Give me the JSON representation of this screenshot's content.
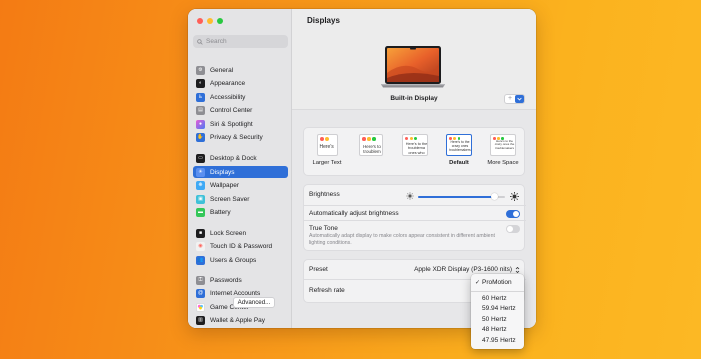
{
  "window": {
    "title": "Displays"
  },
  "sidebar": {
    "search_placeholder": "Search",
    "items": [
      {
        "label": "General",
        "icon": "gear-icon",
        "color": "#8e8e93"
      },
      {
        "label": "Appearance",
        "icon": "appearance-icon",
        "color": "#1d1d1f"
      },
      {
        "label": "Accessibility",
        "icon": "accessibility-icon",
        "color": "#2f6fd8"
      },
      {
        "label": "Control Center",
        "icon": "control-center-icon",
        "color": "#8e8e93"
      },
      {
        "label": "Siri & Spotlight",
        "icon": "siri-icon",
        "color": "#6b4de6"
      },
      {
        "label": "Privacy & Security",
        "icon": "hand-icon",
        "color": "#2f6fd8"
      },
      {
        "label": "Desktop & Dock",
        "icon": "dock-icon",
        "color": "#1d1d1f"
      },
      {
        "label": "Displays",
        "icon": "sun-icon",
        "color": "#2f6fd8",
        "active": true
      },
      {
        "label": "Wallpaper",
        "icon": "wallpaper-icon",
        "color": "#3fa9f5"
      },
      {
        "label": "Screen Saver",
        "icon": "screen-saver-icon",
        "color": "#3fc1d8"
      },
      {
        "label": "Battery",
        "icon": "battery-icon",
        "color": "#34c759"
      },
      {
        "label": "Lock Screen",
        "icon": "lock-icon",
        "color": "#1d1d1f"
      },
      {
        "label": "Touch ID & Password",
        "icon": "fingerprint-icon",
        "color": "#ff5f57"
      },
      {
        "label": "Users & Groups",
        "icon": "users-icon",
        "color": "#2f6fd8"
      },
      {
        "label": "Passwords",
        "icon": "key-icon",
        "color": "#8e8e93"
      },
      {
        "label": "Internet Accounts",
        "icon": "at-icon",
        "color": "#2f6fd8"
      },
      {
        "label": "Game Center",
        "icon": "game-center-icon",
        "color": "#ffffff"
      },
      {
        "label": "Wallet & Apple Pay",
        "icon": "wallet-icon",
        "color": "#1d1d1f"
      }
    ]
  },
  "main": {
    "display_name": "Built-in Display",
    "resolutions": [
      {
        "label": "Larger Text",
        "sample": "Here's"
      },
      {
        "label": "",
        "sample": "Here's to troublem"
      },
      {
        "label": "",
        "sample": "Here's to the troublema ones who"
      },
      {
        "label": "Default",
        "sample": "Here's to the crazy ones troublemakers",
        "selected": true
      },
      {
        "label": "More Space",
        "sample": "Here's to the crazy ones the troublemakers"
      }
    ],
    "brightness": {
      "label": "Brightness",
      "level": 0.88
    },
    "auto_brightness": {
      "label": "Automatically adjust brightness",
      "on": true
    },
    "true_tone": {
      "label": "True Tone",
      "description": "Automatically adapt display to make colors appear consistent in different ambient lighting conditions.",
      "on": false
    },
    "preset": {
      "label": "Preset",
      "value": "Apple XDR Display (P3-1600 nits)"
    },
    "refresh_rate": {
      "label": "Refresh rate"
    },
    "advanced_label": "Advanced..."
  },
  "refresh_menu": {
    "selected": "ProMotion",
    "options": [
      "60 Hertz",
      "59.94 Hertz",
      "50 Hertz",
      "48 Hertz",
      "47.95 Hertz"
    ]
  },
  "colors": {
    "accent": "#2f6fd8",
    "bg_start": "#f47b14",
    "bg_end": "#fcb824"
  }
}
